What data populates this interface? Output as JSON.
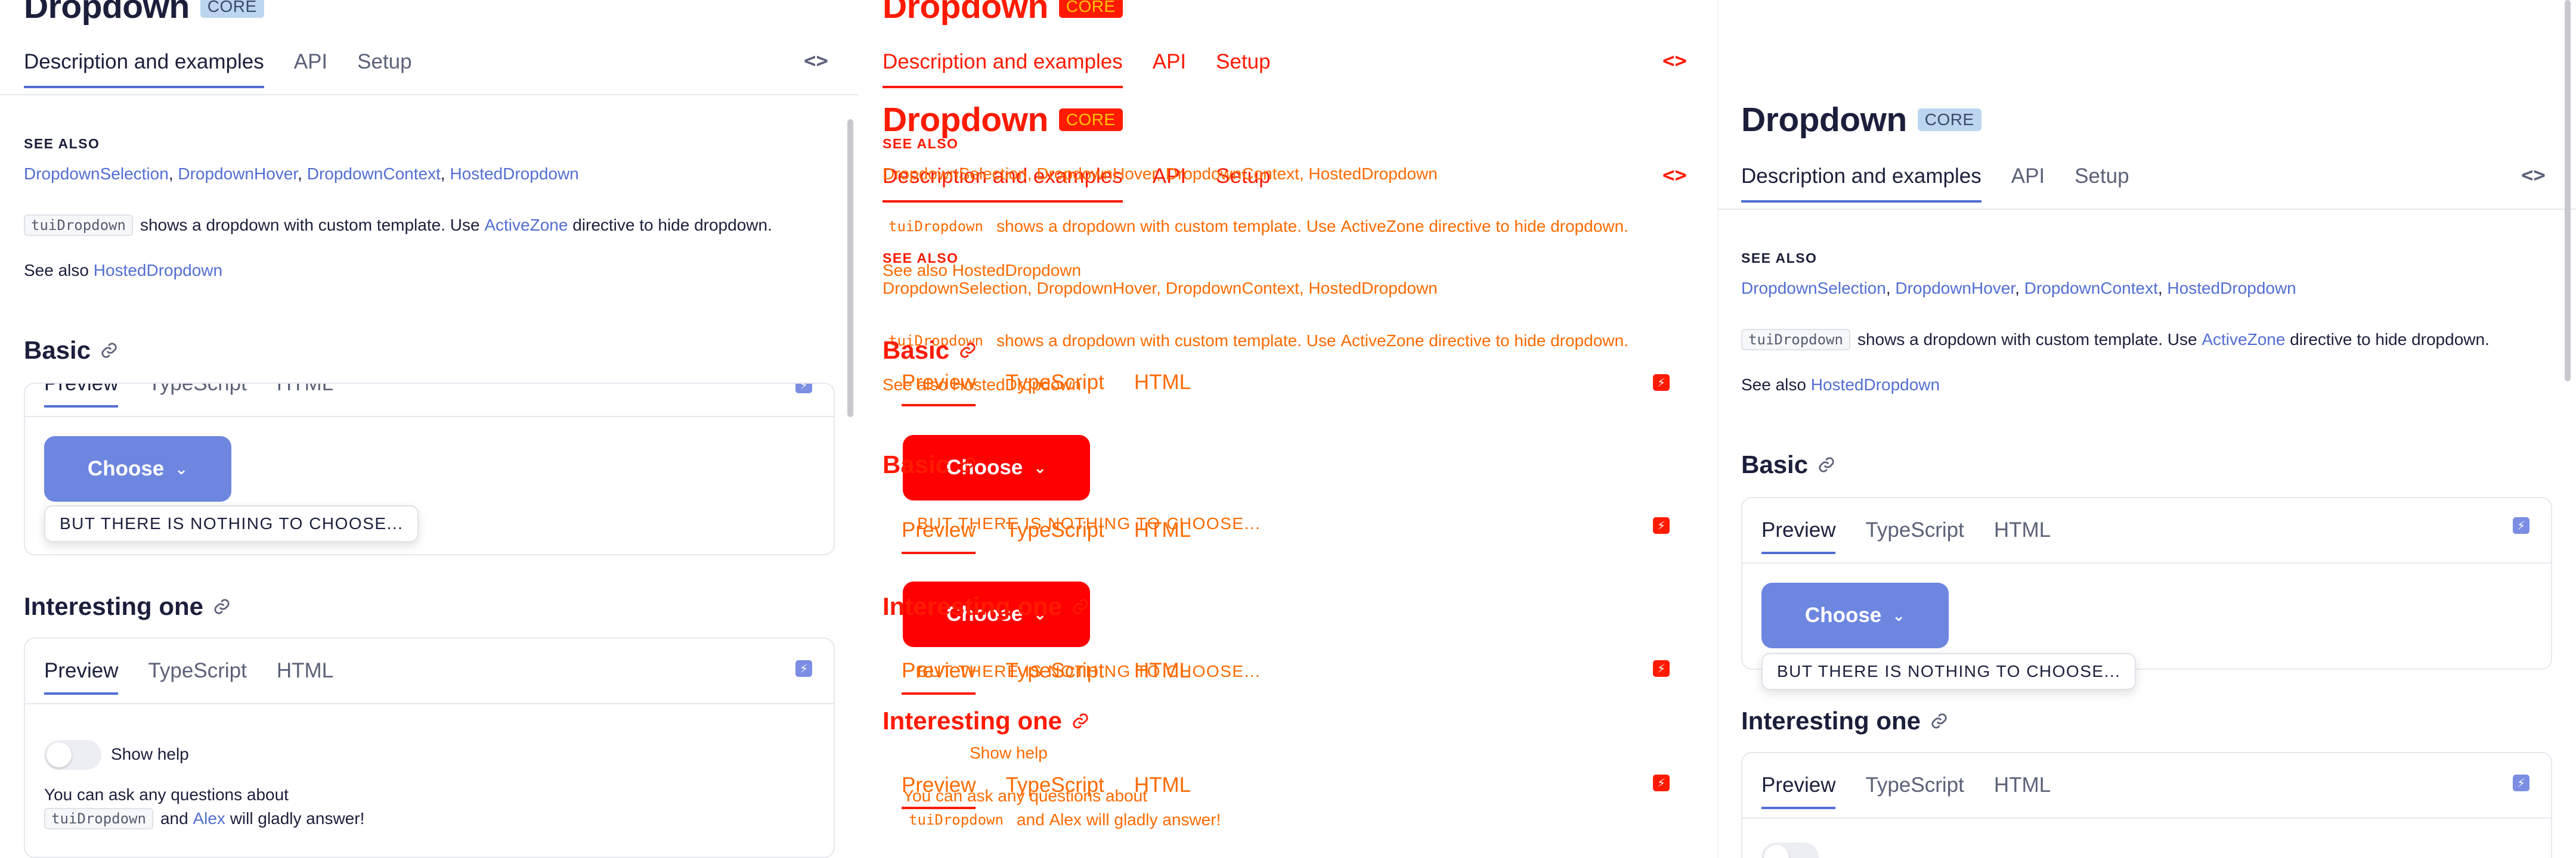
{
  "title": "Dropdown",
  "badge": "CORE",
  "tabs": [
    "Description and examples",
    "API",
    "Setup"
  ],
  "code_toggle_icon": "code-icon",
  "see_also": {
    "label": "SEE ALSO",
    "links": [
      "DropdownSelection",
      "DropdownHover",
      "DropdownContext",
      "HostedDropdown"
    ],
    "sep": ", "
  },
  "intro": {
    "code": "tuiDropdown",
    "text_a": "shows a dropdown with custom template. Use",
    "link": "ActiveZone",
    "text_b": "directive to hide dropdown."
  },
  "see_also_line": {
    "prefix": "See also",
    "link": "HostedDropdown"
  },
  "basic": {
    "heading": "Basic",
    "demo_tabs": [
      "Preview",
      "TypeScript",
      "HTML"
    ],
    "button_label": "Choose",
    "dropdown_text": "BUT THERE IS NOTHING TO CHOOSE..."
  },
  "interesting": {
    "heading": "Interesting one",
    "demo_tabs": [
      "Preview",
      "TypeScript",
      "HTML"
    ],
    "toggle_label": "Show help",
    "line1": "You can ask any questions about",
    "code": "tuiDropdown",
    "and": "and",
    "alex": "Alex",
    "gladly": "will gladly answer!"
  },
  "colors": {
    "accent": "#526ed3",
    "button": "#6d86e0",
    "glitch_red": "#ff1a00",
    "glitch_orange": "#ff6a00"
  }
}
